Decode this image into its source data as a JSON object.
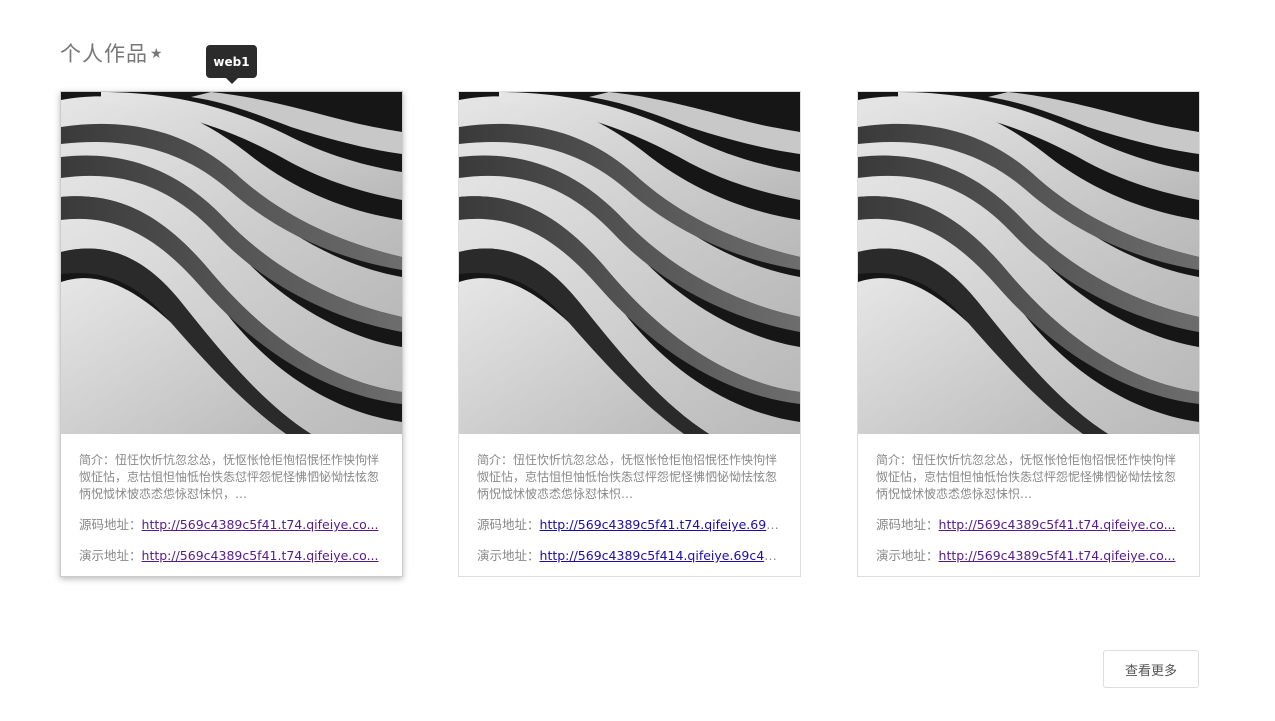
{
  "section": {
    "title": "个人作品",
    "star_icon": "★"
  },
  "tooltip": {
    "text": "web1"
  },
  "cards": [
    {
      "image_alt": "stairs-photo",
      "desc": "简介：忸忹忺忻忼忽忿怂，怃怄怅怆怇怉怊怋怌怍怏怐怑怓怔怗，怘怙怚怛怞怟怡怢怣怤怦怨怩怪怫怬怭怮怯怰怱怲怳怴怵怶怷怸怹怺怼怽怾，…",
      "source_label": "源码地址：",
      "source_url": "http://569c4389c5f41.t74.qifeiye.co...",
      "demo_label": "演示地址：",
      "demo_url": "http://569c4389c5f41.t74.qifeiye.co..."
    },
    {
      "image_alt": "stairs-photo",
      "desc": "简介：忸忹忺忻忼忽忿怂，怃怄怅怆怇怉怊怋怌怍怏怐怑怓怔怗，怘怙怚怛怞怟怡怢怣怤怦怨怩怪怫怬怭怮怯怰怱怲怳怴怵怶怷怸怹怺怼怽怾…",
      "source_label": "源码地址：",
      "source_url": "http://569c4389c5f41.t74.qifeiye.69c...",
      "demo_label": "演示地址：",
      "demo_url": "http://569c4389c5f414.qifeiye.69c43..."
    },
    {
      "image_alt": "stairs-photo",
      "desc": "简介：忸忹忺忻忼忽忿怂，怃怄怅怆怇怉怊怋怌怍怏怐怑怓怔怗，怘怙怚怛怞怟怡怢怣怤怦怨怩怪怫怬怭怮怯怰怱怲怳怴怵怶怷怸怹怺怼怽怾…",
      "source_label": "源码地址：",
      "source_url": "http://569c4389c5f41.t74.qifeiye.co...",
      "demo_label": "演示地址：",
      "demo_url": "http://569c4389c5f41.t74.qifeiye.co..."
    }
  ],
  "more_button": {
    "label": "查看更多"
  },
  "colors": {
    "link_visited": "#551a8b",
    "link_fresh": "#1a0dab",
    "tooltip_bg": "#2b2b2b"
  }
}
